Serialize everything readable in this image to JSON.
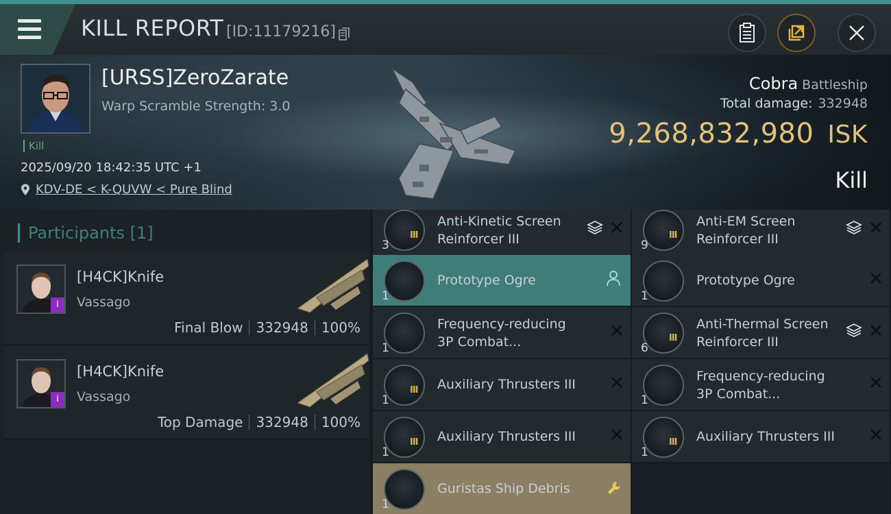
{
  "header": {
    "title": "KILL REPORT",
    "report_id": "[ID:11179216]",
    "icons": [
      "menu-icon",
      "copy-icon",
      "clipboard-icon",
      "share-icon",
      "close-icon"
    ]
  },
  "victim": {
    "name": "[URSS]ZeroZarate",
    "warp_scramble": "Warp Scramble Strength: 3.0",
    "tag": "Kill",
    "datetime": "2025/09/20 18:42:35 UTC +1",
    "location": "KDV-DE < K-QUVW < Pure Blind",
    "ship": "Cobra",
    "ship_class": "Battleship",
    "total_damage_label": "Total damage:",
    "total_damage": "332948",
    "isk_value": "9,268,832,980",
    "isk_unit": "ISK",
    "kill_type": "Kill"
  },
  "participants": {
    "title": "Participants",
    "count": "[1]",
    "items": [
      {
        "name": "[H4CK]Knife",
        "ship": "Vassago",
        "role": "Final Blow",
        "damage": "332948",
        "percent": "100%",
        "badge": "i"
      },
      {
        "name": "[H4CK]Knife",
        "ship": "Vassago",
        "role": "Top Damage",
        "damage": "332948",
        "percent": "100%",
        "badge": "i"
      }
    ]
  },
  "modules": [
    {
      "name": "Anti-Kinetic Screen Reinforcer III",
      "qty": "3",
      "tier": "III",
      "state": "normal",
      "icon": "shield-module-icon"
    },
    {
      "name": "Anti-EM Screen Reinforcer III",
      "qty": "9",
      "tier": "III",
      "state": "normal",
      "icon": "shield-module-icon"
    },
    {
      "name": "Prototype  Ogre",
      "qty": "1",
      "tier": "",
      "state": "highlight",
      "icon": "drone-icon"
    },
    {
      "name": "Prototype  Ogre",
      "qty": "1",
      "tier": "",
      "state": "normal",
      "icon": "drone-icon"
    },
    {
      "name": "Frequency-reducing 3P Combat...",
      "qty": "1",
      "tier": "",
      "state": "normal",
      "icon": "implant-icon"
    },
    {
      "name": "Anti-Thermal Screen Reinforcer III",
      "qty": "6",
      "tier": "III",
      "state": "normal",
      "icon": "shield-module-icon"
    },
    {
      "name": "Auxiliary Thrusters III",
      "qty": "1",
      "tier": "III",
      "state": "normal",
      "icon": "thruster-icon"
    },
    {
      "name": "Frequency-reducing 3P Combat...",
      "qty": "1",
      "tier": "",
      "state": "normal",
      "icon": "implant-icon"
    },
    {
      "name": "Auxiliary Thrusters III",
      "qty": "1",
      "tier": "III",
      "state": "normal",
      "icon": "thruster-icon"
    },
    {
      "name": "Auxiliary Thrusters III",
      "qty": "1",
      "tier": "III",
      "state": "normal",
      "icon": "thruster-icon"
    },
    {
      "name": "Guristas Ship Debris",
      "qty": "1",
      "tier": "",
      "state": "debris",
      "icon": "debris-icon"
    }
  ],
  "colors": {
    "accent": "#3f8f8a",
    "isk": "#e2c27a",
    "highlight_row": "#3e7d78",
    "debris_row": "#8a7f63",
    "badge": "#8b2ebf"
  }
}
